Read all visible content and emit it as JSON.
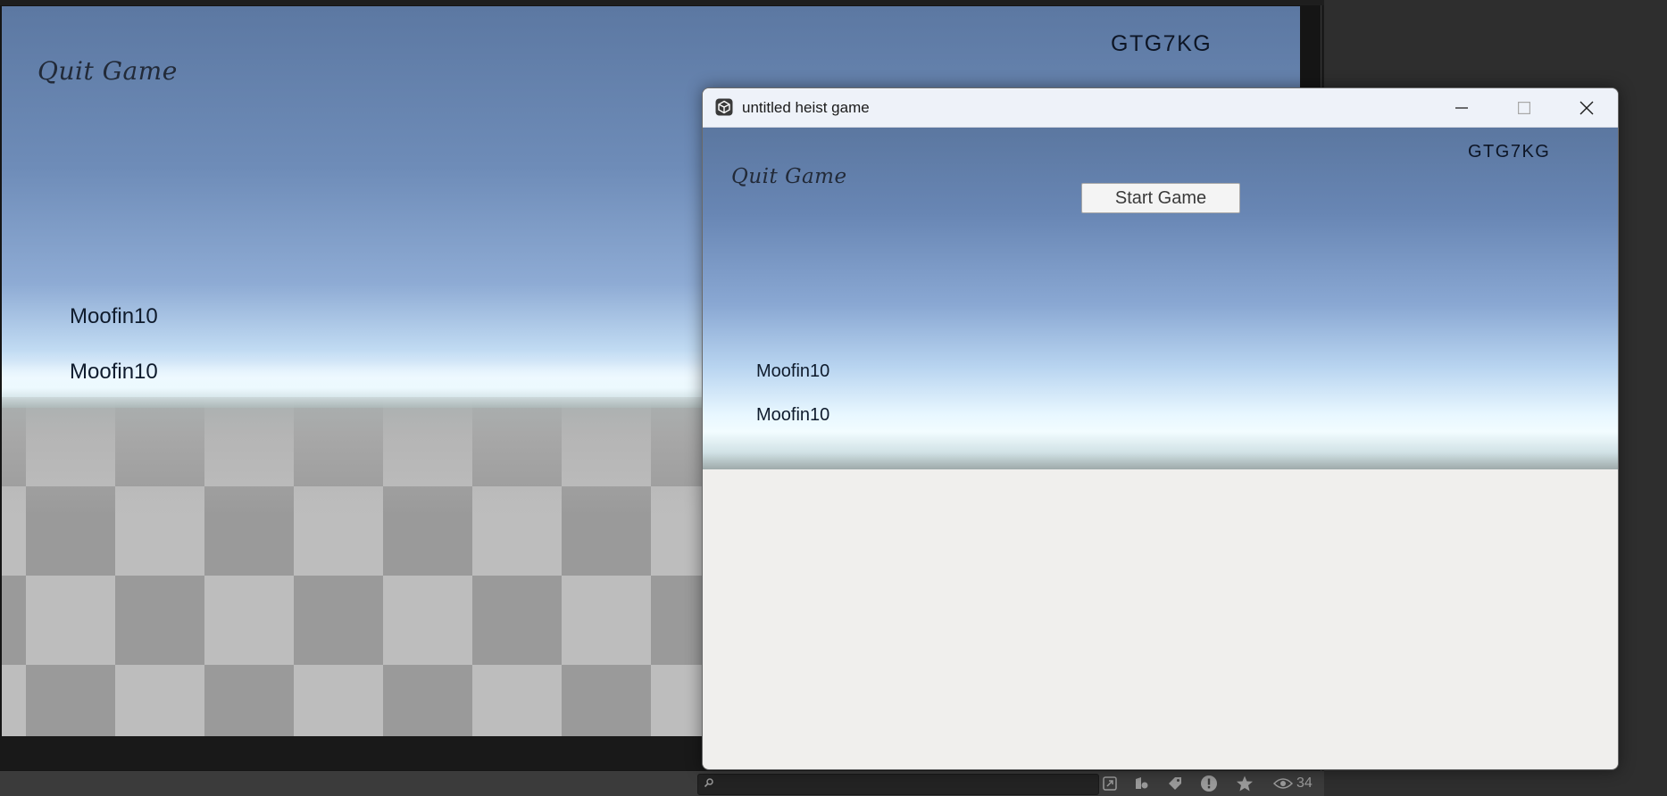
{
  "editor": {
    "game_view": {
      "quit_label": "Quit Game",
      "room_code": "GTG7KG",
      "players": [
        "Moofin10",
        "Moofin10"
      ]
    },
    "status_bar": {
      "search_placeholder": "",
      "icons": [
        "scene-visibility-icon",
        "layers-icon",
        "tag-icon",
        "error-icon",
        "star-icon"
      ],
      "visible_count": "34"
    }
  },
  "window": {
    "title": "untitled heist game",
    "controls": [
      "minimize",
      "maximize",
      "close"
    ],
    "game": {
      "quit_label": "Quit Game",
      "room_code": "GTG7KG",
      "start_label": "Start Game",
      "players": [
        "Moofin10",
        "Moofin10"
      ]
    }
  },
  "colors": {
    "sky_top": "#5c78a2",
    "horizon": "#eef8ff",
    "floor_light": "#bdbdbd",
    "floor_dark": "#9a9a9a",
    "editor_bg": "#2b2b2b"
  }
}
